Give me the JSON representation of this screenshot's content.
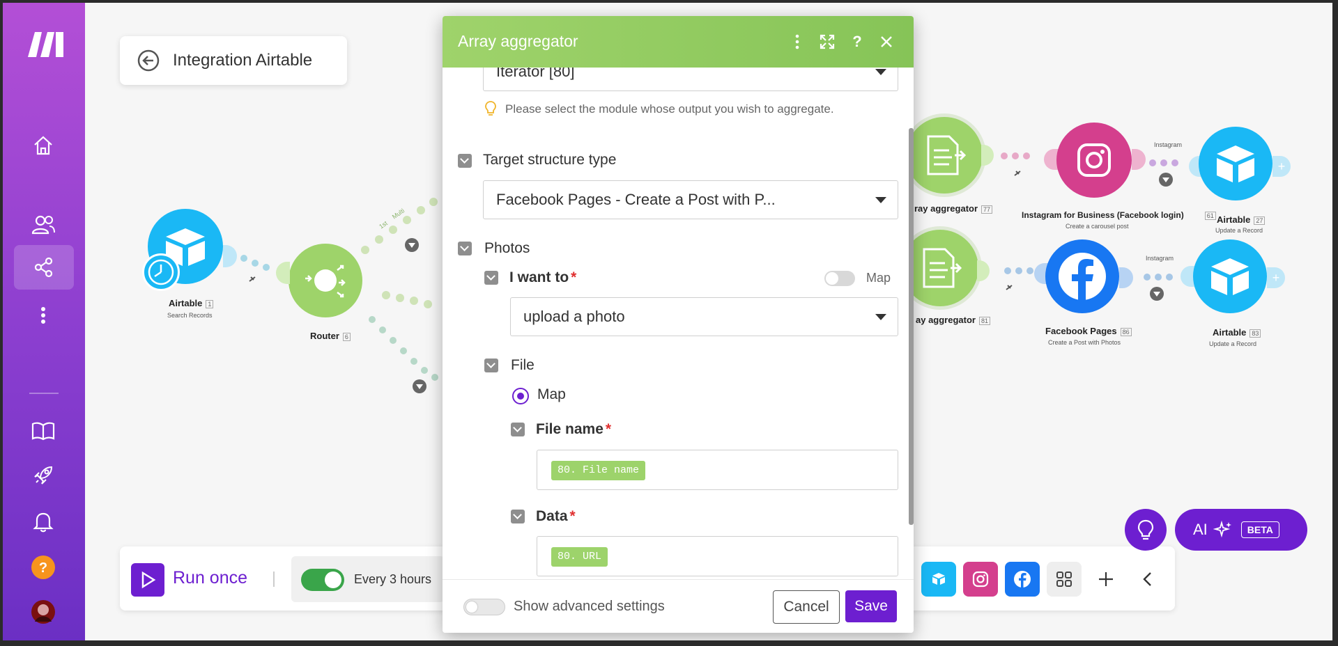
{
  "scenario": {
    "title": "Integration Airtable"
  },
  "canvas": {
    "nodes": [
      {
        "label": "Airtable",
        "num": "1",
        "sub": "Search Records"
      },
      {
        "label": "Router",
        "num": "6",
        "sub": ""
      },
      {
        "label": "ray aggregator",
        "num": "77",
        "sub": ""
      },
      {
        "label": "ay aggregator",
        "num": "81",
        "sub": ""
      },
      {
        "label": "Instagram for Business (Facebook login)",
        "num": "61",
        "sub": "Create a carousel post"
      },
      {
        "label": "Facebook Pages",
        "num": "86",
        "sub": "Create a Post with Photos"
      },
      {
        "label": "Airtable",
        "num": "27",
        "sub": "Update a Record"
      },
      {
        "label": "Airtable",
        "num": "83",
        "sub": "Update a Record"
      }
    ],
    "route_labels": {
      "first": "1st",
      "multi": "Multi",
      "instagram_top": "Instagram",
      "instagram_bottom": "Instagram"
    }
  },
  "toolbar": {
    "run_label": "Run once",
    "schedule_label": "Every 3 hours",
    "schedule_on": true
  },
  "ai": {
    "label": "AI",
    "badge": "BETA"
  },
  "modal": {
    "title": "Array aggregator",
    "source_module": "Iterator [80]",
    "source_hint": "Please select the module whose output you wish to aggregate.",
    "target_label": "Target structure type",
    "target_value": "Facebook Pages - Create a Post with P...",
    "photos_label": "Photos",
    "i_want_to_label": "I want to",
    "map_label": "Map",
    "i_want_to_value": "upload a photo",
    "file_label": "File",
    "radio_label": "Map",
    "file_name_label": "File name",
    "file_name_value": "80. File name",
    "data_label": "Data",
    "data_value": "80. URL",
    "advanced_label": "Show advanced settings",
    "cancel_label": "Cancel",
    "save_label": "Save",
    "required_mark": "*"
  },
  "colors": {
    "accent": "#6d1fd0",
    "header_green": "#9fd36b",
    "airtable_blue": "#1ab8f5",
    "instagram": "#d43f8d",
    "facebook": "#1877f2",
    "module_green": "#9ed36a"
  }
}
